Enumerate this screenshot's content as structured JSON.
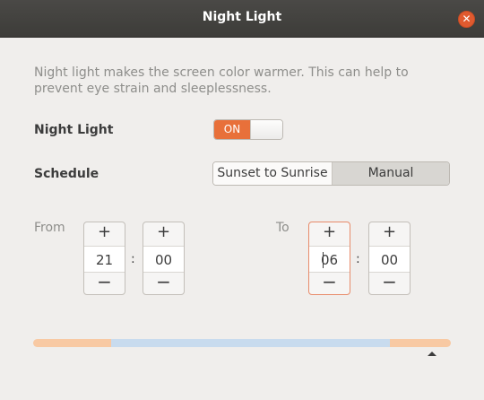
{
  "window": {
    "title": "Night Light",
    "close_icon": "close-icon"
  },
  "description": "Night light makes the screen color warmer. This can help to prevent eye strain and sleeplessness.",
  "night_light": {
    "label": "Night Light",
    "toggle_text": "ON",
    "state": true
  },
  "schedule": {
    "label": "Schedule",
    "options": [
      "Sunset to Sunrise",
      "Manual"
    ],
    "selected": "Manual"
  },
  "from": {
    "label": "From",
    "hours": "21",
    "minutes": "00"
  },
  "to": {
    "label": "To",
    "hours": "06",
    "minutes": "00"
  },
  "spinner": {
    "plus": "+",
    "minus": "−",
    "separator": ":"
  },
  "timeline": {
    "warm_color": "#f8c9a3",
    "cool_color": "#c8dbee",
    "accent_color": "#e8703a"
  }
}
